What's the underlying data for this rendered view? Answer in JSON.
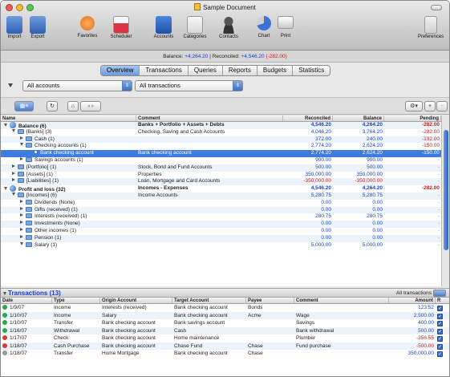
{
  "window": {
    "title": "Sample Document",
    "colors": {
      "close": "#ee5b54",
      "minimize": "#f5bd2e",
      "zoom": "#61c554",
      "accent": "#3f7ce0",
      "negative": "#d41a1a",
      "positive": "#1a3fd0"
    }
  },
  "toolbar": {
    "items": [
      {
        "label": "Import",
        "icon": "import-icon"
      },
      {
        "label": "Export",
        "icon": "export-icon"
      },
      {
        "label": "Favorites",
        "icon": "favorites-heart-icon"
      },
      {
        "label": "Scheduler",
        "icon": "scheduler-calendar-icon"
      },
      {
        "label": "Accounts",
        "icon": "accounts-icon"
      },
      {
        "label": "Categories",
        "icon": "categories-icon"
      },
      {
        "label": "Contacts",
        "icon": "contacts-icon"
      },
      {
        "label": "Chart",
        "icon": "chart-icon"
      },
      {
        "label": "Print",
        "icon": "print-icon"
      },
      {
        "label": "Preferences",
        "icon": "preferences-icon"
      }
    ]
  },
  "balance_bar": {
    "balance_label": "Balance:",
    "balance_value": "+4,264.20",
    "separator": "|",
    "reconciled_label": "Reconciled:",
    "reconciled_value": "+4,546.20",
    "reconciled_diff": "(-282.00)"
  },
  "tabs": [
    {
      "label": "Overview",
      "active": true
    },
    {
      "label": "Transactions",
      "active": false
    },
    {
      "label": "Queries",
      "active": false
    },
    {
      "label": "Reports",
      "active": false
    },
    {
      "label": "Budgets",
      "active": false
    },
    {
      "label": "Statistics",
      "active": false
    }
  ],
  "filters": {
    "accounts_value": "All accounts",
    "transactions_value": "All transactions"
  },
  "tree": {
    "columns": [
      "Name",
      "Comment",
      "Reconciled",
      "Balance",
      "Pending"
    ],
    "rows": [
      {
        "name": "Balance (6)",
        "comment": "Banks + Portfolio + Assets + Debts",
        "reconciled": "4,546.20",
        "balance": "4,264.20",
        "pending": "-282.00",
        "bold": true
      },
      {
        "name": "[Banks] (3)",
        "comment": "Checking, Saving and Cash Accounts",
        "reconciled": "4,046.20",
        "balance": "3,764.20",
        "pending": "-282.00",
        "bold": false
      },
      {
        "name": "Cash (1)",
        "comment": "",
        "reconciled": "372.00",
        "balance": "240.00",
        "pending": "-132.00",
        "bold": false
      },
      {
        "name": "Checking accounts (1)",
        "comment": "",
        "reconciled": "2,774.20",
        "balance": "2,624.20",
        "pending": "-150.00",
        "bold": false
      },
      {
        "name": "Bank checking account",
        "comment": "Bank checking account",
        "reconciled": "2,774.20",
        "balance": "2,624.20",
        "pending": "-150.00",
        "bold": false,
        "selected": true
      },
      {
        "name": "Savings accounts (1)",
        "comment": "",
        "reconciled": "900.00",
        "balance": "900.00",
        "pending": "-",
        "bold": false
      },
      {
        "name": "[Portfolio] (1)",
        "comment": "Stock, Bond and Fund Accounts",
        "reconciled": "500.00",
        "balance": "500.00",
        "pending": "-",
        "bold": false
      },
      {
        "name": "[Assets] (1)",
        "comment": "Properties",
        "reconciled": "350,000.00",
        "balance": "350,000.00",
        "pending": "-",
        "bold": false
      },
      {
        "name": "[Liabilities] (1)",
        "comment": "Loan, Mortgage and Card Accounts",
        "reconciled": "-350,000.00",
        "balance": "-350,000.00",
        "pending": "-",
        "bold": false
      },
      {
        "name": "Profit and loss (32)",
        "comment": "Incomes - Expenses",
        "reconciled": "4,546.20",
        "balance": "4,264.20",
        "pending": "-282.00",
        "bold": true
      },
      {
        "name": "[Incomes] (6)",
        "comment": "Income Accounts",
        "reconciled": "5,280.75",
        "balance": "5,280.75",
        "pending": "-",
        "bold": false
      },
      {
        "name": "Dividends (None)",
        "comment": "",
        "reconciled": "0.00",
        "balance": "0.00",
        "pending": "-",
        "bold": false
      },
      {
        "name": "Gifts (received) (1)",
        "comment": "",
        "reconciled": "0.00",
        "balance": "0.00",
        "pending": "-",
        "bold": false
      },
      {
        "name": "Interests (received) (1)",
        "comment": "",
        "reconciled": "280.75",
        "balance": "280.75",
        "pending": "-",
        "bold": false
      },
      {
        "name": "Investments (None)",
        "comment": "",
        "reconciled": "0.00",
        "balance": "0.00",
        "pending": "-",
        "bold": false
      },
      {
        "name": "Other incomes (1)",
        "comment": "",
        "reconciled": "0.00",
        "balance": "0.00",
        "pending": "-",
        "bold": false
      },
      {
        "name": "Pension (1)",
        "comment": "",
        "reconciled": "0.00",
        "balance": "0.00",
        "pending": "-",
        "bold": false
      },
      {
        "name": "Salary (1)",
        "comment": "",
        "reconciled": "5,000.00",
        "balance": "5,000.00",
        "pending": "-",
        "bold": false
      }
    ]
  },
  "transactions": {
    "title": "Transactions (13)",
    "filter_label": "All transactions",
    "columns": [
      "Date",
      "Type",
      "Origin Account",
      "Target Account",
      "Payee",
      "Comment",
      "Amount",
      "R"
    ],
    "rows": [
      {
        "date": "1/9/07",
        "type": "Income",
        "origin": "Interests (received)",
        "target": "Bank checking account",
        "payee": "Bonds",
        "comment": "",
        "amount": "123.52",
        "status": "green",
        "negative": false
      },
      {
        "date": "1/10/07",
        "type": "Income",
        "origin": "Salary",
        "target": "Bank checking account",
        "payee": "Acme",
        "comment": "Wage",
        "amount": "2,500.00",
        "status": "green",
        "negative": false
      },
      {
        "date": "1/10/07",
        "type": "Transfer",
        "origin": "Bank checking account",
        "target": "Bank savings account",
        "payee": "",
        "comment": "Savings",
        "amount": "400.00",
        "status": "green",
        "negative": false
      },
      {
        "date": "1/16/07",
        "type": "Withdrawal",
        "origin": "Bank checking account",
        "target": "Cash",
        "payee": "",
        "comment": "Bank withdrawal",
        "amount": "500.00",
        "status": "green",
        "negative": false
      },
      {
        "date": "1/17/07",
        "type": "Check",
        "origin": "Bank checking account",
        "target": "Home maintenance",
        "payee": "",
        "comment": "Plumber",
        "amount": "-356.55",
        "status": "red",
        "negative": true
      },
      {
        "date": "1/18/07",
        "type": "Cash Purchase",
        "origin": "Bank checking account",
        "target": "Chase Fund",
        "payee": "Chase",
        "comment": "Fund purchase",
        "amount": "-500.00",
        "status": "red",
        "negative": true
      },
      {
        "date": "1/18/07",
        "type": "Transfer",
        "origin": "Home Mortgage",
        "target": "Bank checking account",
        "payee": "Chase",
        "comment": "",
        "amount": "350,000.00",
        "status": "grey",
        "negative": false
      }
    ]
  }
}
